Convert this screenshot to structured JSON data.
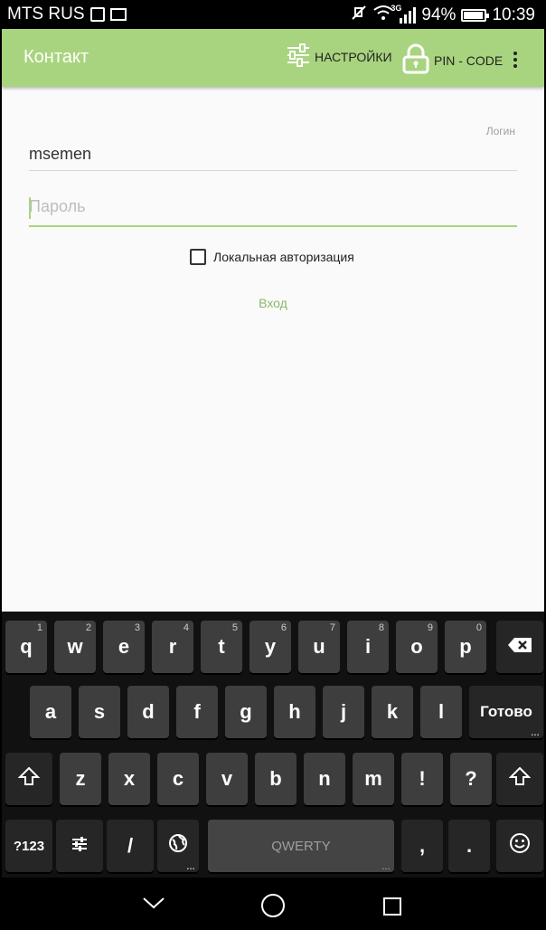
{
  "status_bar": {
    "carrier": "MTS RUS",
    "network_type": "3G",
    "battery": "94%",
    "time": "10:39"
  },
  "app_bar": {
    "title": "Контакт",
    "settings_label": "НАСТРОЙКИ",
    "pin_label": "PIN - CODE",
    "settings_icon": "sliders-icon",
    "pin_icon": "lock-icon",
    "menu_icon": "more-vert-icon",
    "color": "#a9d47f"
  },
  "form": {
    "login_label": "Логин",
    "login_value": "msemen",
    "password_placeholder": "Пароль",
    "local_auth_label": "Локальная авторизация",
    "local_auth_checked": false,
    "enter_label": "Вход"
  },
  "keyboard": {
    "row1": [
      {
        "k": "q",
        "a": "1"
      },
      {
        "k": "w",
        "a": "2"
      },
      {
        "k": "e",
        "a": "3"
      },
      {
        "k": "r",
        "a": "4"
      },
      {
        "k": "t",
        "a": "5"
      },
      {
        "k": "y",
        "a": "6"
      },
      {
        "k": "u",
        "a": "7"
      },
      {
        "k": "i",
        "a": "8"
      },
      {
        "k": "o",
        "a": "9"
      },
      {
        "k": "p",
        "a": "0"
      }
    ],
    "row2": [
      "a",
      "s",
      "d",
      "f",
      "g",
      "h",
      "j",
      "k",
      "l"
    ],
    "row3": [
      "z",
      "x",
      "c",
      "v",
      "b",
      "n",
      "m",
      "!",
      "?"
    ],
    "done_label": "Готово",
    "sym_label": "?123",
    "slash_label": "/",
    "space_label": "QWERTY",
    "comma_label": ",",
    "period_label": "."
  }
}
